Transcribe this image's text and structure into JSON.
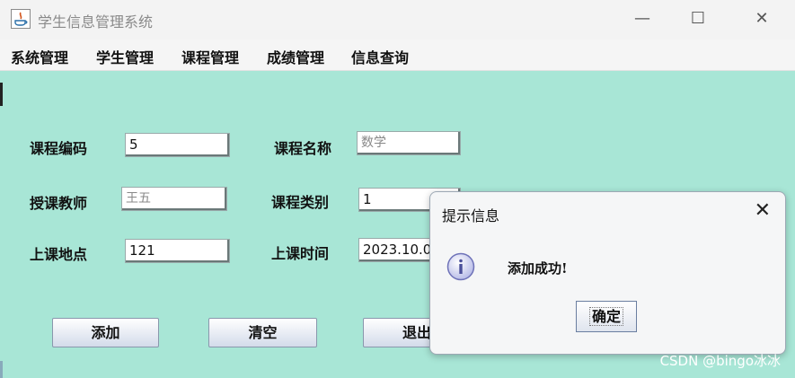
{
  "window": {
    "title": "学生信息管理系统",
    "controls": {
      "minimize": "—",
      "maximize": "☐",
      "close": "✕"
    }
  },
  "menu": {
    "items": [
      "系统管理",
      "学生管理",
      "课程管理",
      "成绩管理",
      "信息查询"
    ]
  },
  "form": {
    "course_code": {
      "label": "课程编码",
      "value": "5"
    },
    "course_name": {
      "label": "课程名称",
      "value": "数学"
    },
    "teacher": {
      "label": "授课教师",
      "value": "王五"
    },
    "course_type": {
      "label": "课程类别",
      "value": "1"
    },
    "location": {
      "label": "上课地点",
      "value": "121"
    },
    "time": {
      "label": "上课时间",
      "value": "2023.10.0"
    }
  },
  "buttons": {
    "add": "添加",
    "clear": "清空",
    "exit": "退出"
  },
  "dialog": {
    "title": "提示信息",
    "message": "添加成功!",
    "ok": "确定",
    "close": "✕",
    "icon": "info-icon"
  },
  "watermark": "CSDN @bingo冰冰",
  "colors": {
    "content_bg": "#a8e6d6",
    "titlebar_bg": "#f3f3f3"
  }
}
